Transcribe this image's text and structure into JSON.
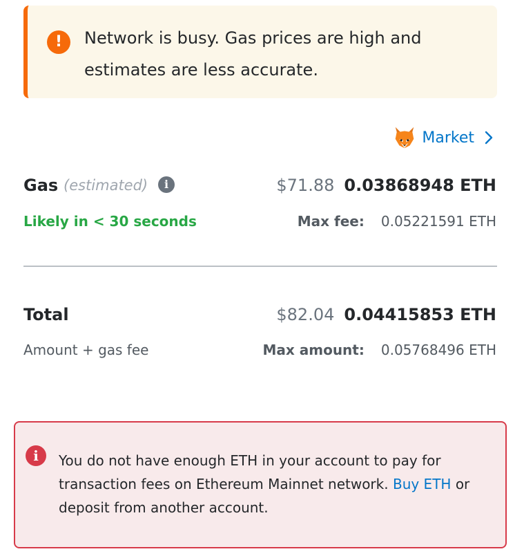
{
  "warning": {
    "icon": "exclamation-icon",
    "color": "#f66a0a",
    "text": "Network is busy. Gas prices are high and estimates are less accurate."
  },
  "market": {
    "label": "Market",
    "icon": "fox-icon"
  },
  "gas": {
    "label": "Gas",
    "estimated": "(estimated)",
    "usd": "$71.88",
    "eth": "0.03868948 ETH",
    "likely": "Likely in < 30 seconds",
    "max_fee_label": "Max fee:",
    "max_fee_value": "0.05221591 ETH"
  },
  "total": {
    "label": "Total",
    "usd": "$82.04",
    "eth": "0.04415853 ETH",
    "sub": "Amount + gas fee",
    "max_amount_label": "Max amount:",
    "max_amount_value": "0.05768496 ETH"
  },
  "error": {
    "icon": "info-icon",
    "color": "#d73a49",
    "text_before": "You do not have enough ETH in your account to pay for transaction fees on Ethereum Mainnet network.",
    "buy_link": "Buy ETH",
    "text_after": "or deposit from another account."
  }
}
